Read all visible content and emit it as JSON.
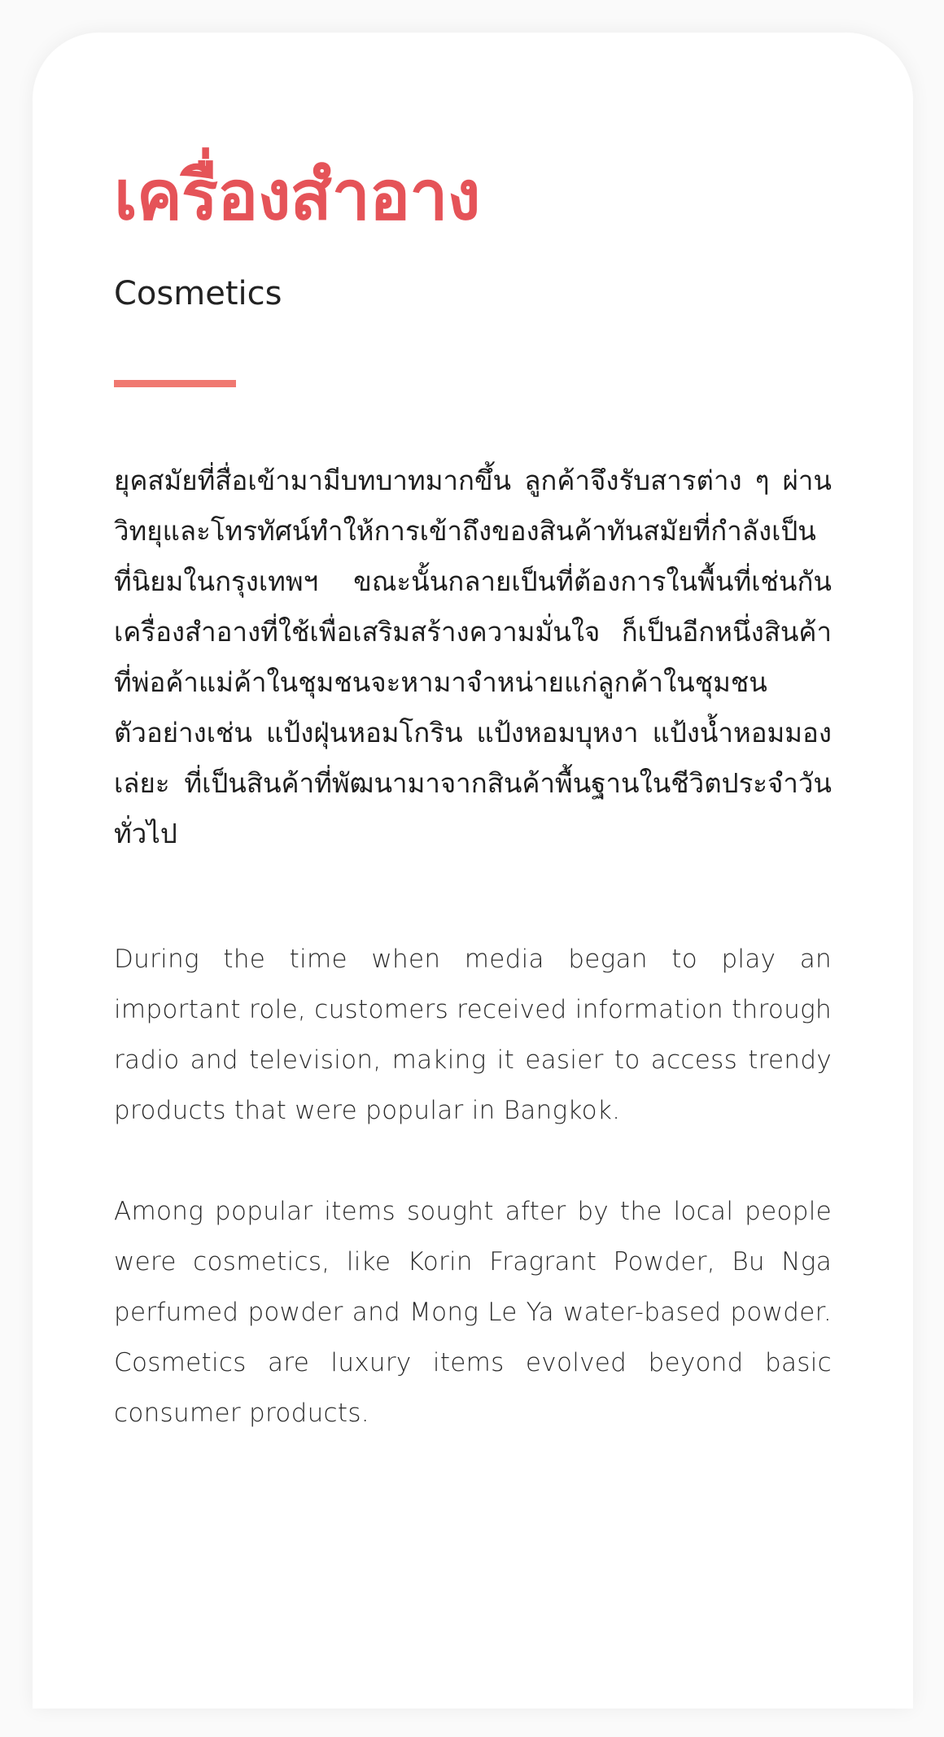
{
  "content": {
    "title_th": "เครื่องสำอาง",
    "title_en": "Cosmetics",
    "paragraph_th": "ยุคสมัยที่สื่อเข้ามามีบทบาทมากขึ้น ลูกค้าจึงรับสารต่าง ๆ ผ่านวิทยุและโทรทัศน์ทำให้การเข้าถึงของสินค้าทันสมัยที่กำลังเป็นที่นิยมในกรุงเทพฯ ขณะนั้นกลายเป็นที่ต้องการในพื้นที่เช่นกัน เครื่องสำอางที่ใช้เพื่อเสริมสร้างความมั่นใจ ก็เป็นอีกหนึ่งสินค้าที่พ่อค้าแม่ค้าในชุมชนจะหามาจำหน่ายแก่ลูกค้าในชุมชน ตัวอย่างเช่น แป้งฝุ่นหอมโกริน แป้งหอมบุหงา แป้งน้ำหอมมองเล่ยะ ที่เป็นสินค้าที่พัฒนามาจากสินค้าพื้นฐานในชีวิตประจำวันทั่วไป",
    "paragraph_en_1": "During the time when media began to play an important role, customers received information through radio and television, making it easier to access trendy products that were popular in Bangkok.",
    "paragraph_en_2": "Among popular items sought after by the local people were cosmetics, like Korin Fragrant Powder, Bu Nga perfumed powder and Mong Le Ya water-based powder. Cosmetics are luxury items evolved beyond basic consumer products."
  },
  "colors": {
    "title": "#e55358",
    "divider": "#f07870",
    "text": "#1e1e1e",
    "background": "#ffffff"
  }
}
